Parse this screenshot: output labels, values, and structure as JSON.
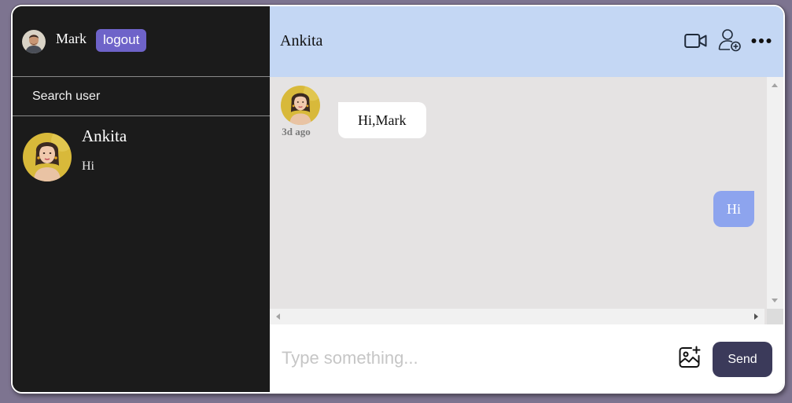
{
  "sidebar": {
    "current_user": {
      "name": "Mark",
      "avatar": "male-user-avatar"
    },
    "logout_label": "logout",
    "search_placeholder": "Search user",
    "chats": [
      {
        "name": "Ankita",
        "last_message": "Hi",
        "avatar": "female-user-avatar"
      }
    ]
  },
  "chat": {
    "header": {
      "name": "Ankita",
      "icons": [
        "video-camera-icon",
        "add-user-icon",
        "more-options-icon"
      ]
    },
    "messages": [
      {
        "direction": "incoming",
        "text": "Hi,Mark",
        "time": "3d ago",
        "avatar": "female-user-avatar"
      },
      {
        "direction": "outgoing",
        "text": "Hi"
      }
    ],
    "composer": {
      "placeholder": "Type something...",
      "value": "",
      "attach_icon": "add-image-icon",
      "send_label": "Send"
    }
  },
  "colors": {
    "page_background": "#7d7490",
    "sidebar_background": "#1b1b1b",
    "header_background": "#c4d7f4",
    "messages_background": "#e5e3e3",
    "logout_button": "#6e63c9",
    "outgoing_bubble": "#8da4ee",
    "incoming_bubble": "#ffffff",
    "send_button": "#3b3a5a"
  }
}
